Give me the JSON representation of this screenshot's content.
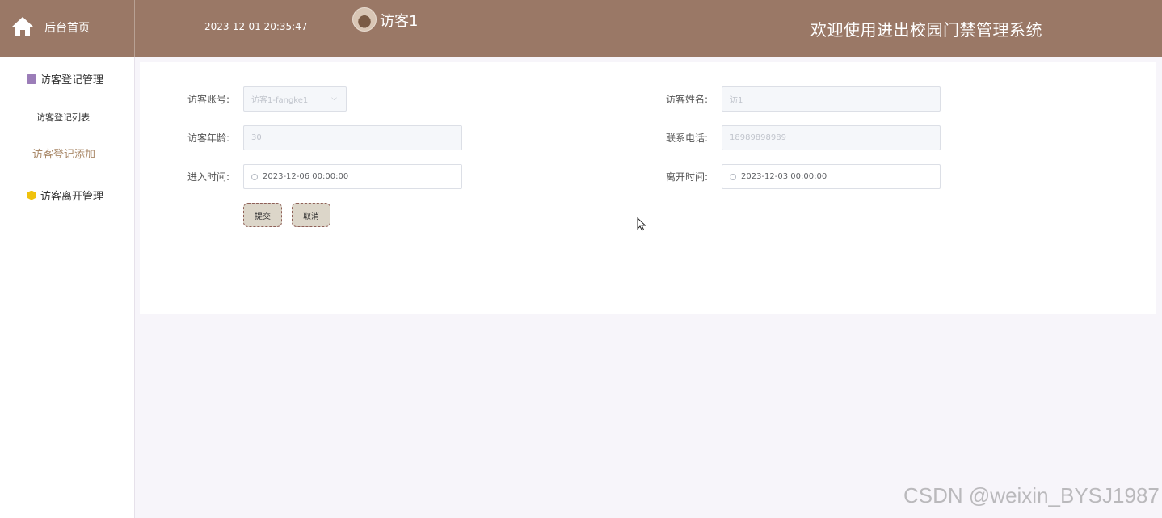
{
  "header": {
    "home_label": "后台首页",
    "datetime": "2023-12-01 20:35:47",
    "username": "访客1",
    "welcome": "欢迎使用进出校园门禁管理系统"
  },
  "sidebar": {
    "groups": [
      {
        "label": "访客登记管理",
        "icon": "box-icon",
        "items": [
          {
            "label": "访客登记列表",
            "active": false
          },
          {
            "label": "访客登记添加",
            "active": true
          }
        ]
      },
      {
        "label": "访客离开管理",
        "icon": "hexagon-icon",
        "items": []
      }
    ]
  },
  "form": {
    "account": {
      "label": "访客账号:",
      "value": "访客1-fangke1"
    },
    "name": {
      "label": "访客姓名:",
      "value": "访1"
    },
    "age": {
      "label": "访客年龄:",
      "value": "30"
    },
    "phone": {
      "label": "联系电话:",
      "value": "18989898989"
    },
    "entry_time": {
      "label": "进入时间:",
      "value": "2023-12-06 00:00:00"
    },
    "leave_time": {
      "label": "离开时间:",
      "value": "2023-12-03 00:00:00"
    },
    "submit_label": "提交",
    "cancel_label": "取消"
  },
  "watermark": "CSDN @weixin_BYSJ1987",
  "colors": {
    "header_bg": "#9a7866",
    "active_menu": "#a98868",
    "button_bg": "#dcd6c9",
    "button_border": "#8e5f57"
  }
}
